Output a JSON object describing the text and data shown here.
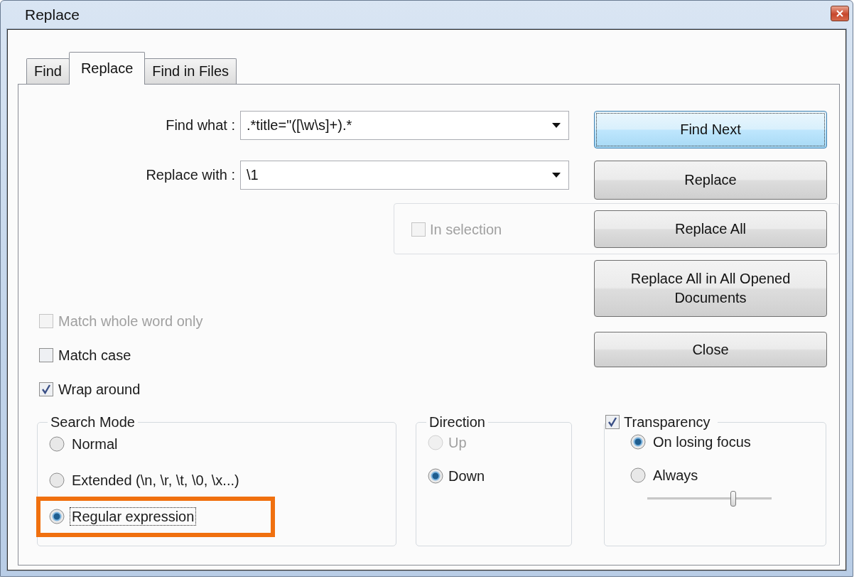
{
  "window": {
    "title": "Replace"
  },
  "tabs": [
    {
      "label": "Find",
      "selected": false
    },
    {
      "label": "Replace",
      "selected": true
    },
    {
      "label": "Find in Files",
      "selected": false
    }
  ],
  "fields": [
    {
      "label": "Find what :",
      "value": ".*title=\"([\\w\\s]+).*"
    },
    {
      "label": "Replace with :",
      "value": "\\1"
    }
  ],
  "in_selection": {
    "label": "In selection",
    "checked": false,
    "disabled": true
  },
  "buttons": [
    {
      "label": "Find Next",
      "focused": true
    },
    {
      "label": "Replace",
      "focused": false
    },
    {
      "label": "Replace All",
      "focused": false
    },
    {
      "label": "Replace All in All Opened Documents",
      "focused": false
    },
    {
      "label": "Close",
      "focused": false
    }
  ],
  "options": [
    {
      "label": "Match whole word only",
      "checked": false,
      "disabled": true
    },
    {
      "label": "Match case",
      "checked": false,
      "disabled": false
    },
    {
      "label": "Wrap around",
      "checked": true,
      "disabled": false
    }
  ],
  "search_mode": {
    "title": "Search Mode",
    "options": [
      {
        "label": "Normal",
        "selected": false,
        "focused": false,
        "highlighted": false
      },
      {
        "label": "Extended (\\n, \\r, \\t, \\0, \\x...)",
        "selected": false,
        "focused": false,
        "highlighted": false
      },
      {
        "label": "Regular expression",
        "selected": true,
        "focused": true,
        "highlighted": true
      }
    ]
  },
  "direction": {
    "title": "Direction",
    "options": [
      {
        "label": "Up",
        "selected": false,
        "disabled": true
      },
      {
        "label": "Down",
        "selected": true,
        "disabled": false
      }
    ]
  },
  "transparency": {
    "label": "Transparency",
    "checked": true,
    "options": [
      {
        "label": "On losing focus",
        "selected": true
      },
      {
        "label": "Always",
        "selected": false
      }
    ],
    "slider": {
      "level": 0.69
    }
  }
}
